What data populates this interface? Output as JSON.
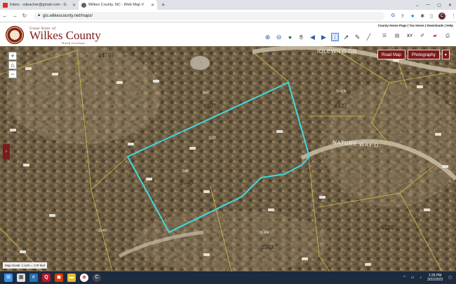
{
  "browser": {
    "tabs": [
      {
        "title": "Inbox - cdeacher@gmail.com - G",
        "favicon_color": "#d93025",
        "active": false
      },
      {
        "title": "Wilkes County, NC - Web Map V",
        "favicon_color": "#5f6368",
        "active": true
      }
    ],
    "new_tab_label": "+",
    "url": "gis.wilkescounty.net/maps/",
    "avatar_letter": "C"
  },
  "header": {
    "logo_great_state": "Great State of",
    "logo_name": "Wilkes County",
    "logo_sub": "North Carolina",
    "links": "County Home Page | Tax Home | Downloads | Help"
  },
  "map": {
    "basemap_buttons": [
      "Road Map",
      "Photography"
    ],
    "basemap_dropdown": "▾",
    "zoom_in": "+",
    "home": "⌂",
    "zoom_out": "−",
    "side_tab": "›",
    "scale_text": "Map Scale: 1 inch = 179 feet",
    "roads": [
      "IDLEWILD DR",
      "NATURE WAY D"
    ],
    "labels": [
      "1476",
      "6107",
      "6127",
      "6740",
      "1343",
      "6120"
    ],
    "small_labels": [
      "1147",
      "1137",
      "1146",
      "11464",
      "1147A",
      "1146"
    ]
  },
  "taskbar": {
    "time": "1:26 PM",
    "date": "3/31/2023"
  }
}
